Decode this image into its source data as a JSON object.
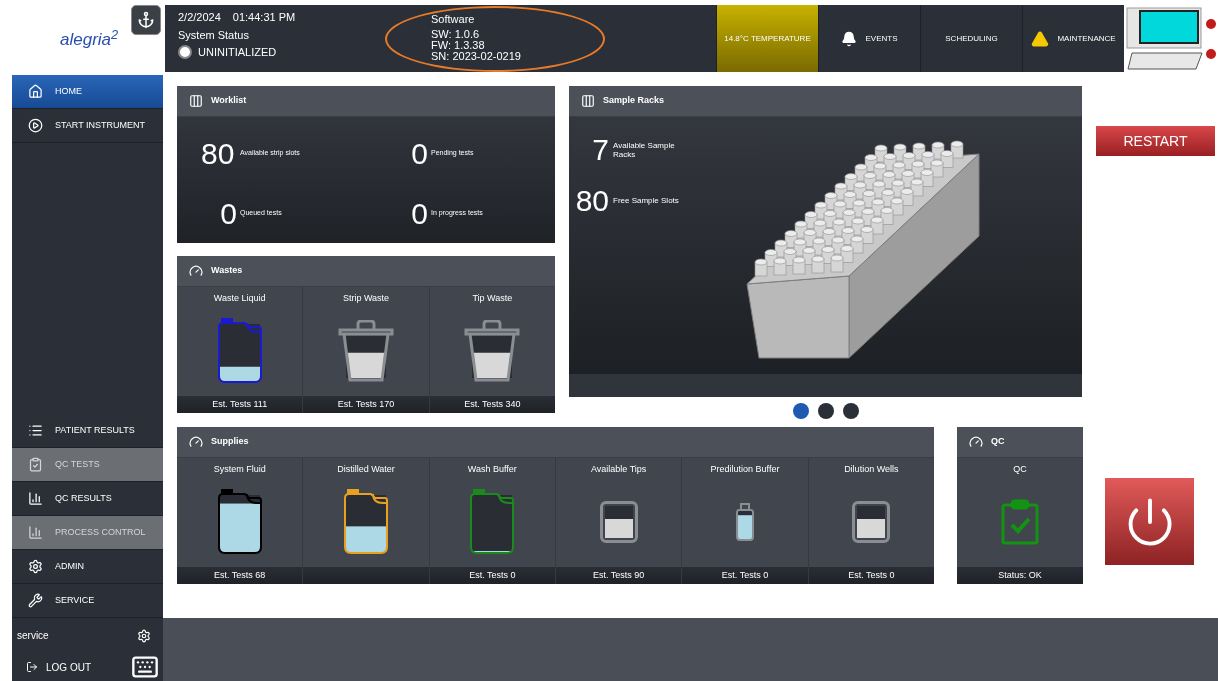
{
  "logo": {
    "text": "alegria$^{2}$"
  },
  "header": {
    "date": "2/2/2024",
    "time": "01:44:31 PM",
    "status_label": "System Status",
    "status": {
      "text": "UNINITIALIZED",
      "on": false
    },
    "software": {
      "title": "Software",
      "lines": [
        "SW: 1.0.6",
        "FW: 1.3.38",
        "SN: 2023-02-0219"
      ],
      "circled": true
    },
    "tabs": [
      {
        "label": "14.8°C TEMPERATURE",
        "kind": "plain",
        "highlighted": true
      },
      {
        "label": "EVENTS",
        "kind": "bell",
        "highlighted": false
      },
      {
        "label": "SCHEDULING",
        "kind": "plain",
        "highlighted": false
      },
      {
        "label": "MAINTENANCE",
        "kind": "warning",
        "highlighted": false
      }
    ]
  },
  "sidebar": {
    "items": [
      {
        "label": "HOME",
        "selected": true,
        "disabled": false
      },
      {
        "label": "START INSTRUMENT",
        "selected": false,
        "disabled": false
      }
    ],
    "lower_items": [
      {
        "label": "PATIENT RESULTS",
        "selected": false,
        "disabled": false
      },
      {
        "label": "QC TESTS",
        "selected": false,
        "disabled": true
      },
      {
        "label": "QC RESULTS",
        "selected": false,
        "disabled": false
      },
      {
        "label": "PROCESS CONTROL",
        "selected": false,
        "disabled": true
      },
      {
        "label": "ADMIN",
        "selected": false,
        "disabled": false
      },
      {
        "label": "SERVICE",
        "selected": false,
        "disabled": false
      }
    ],
    "user": "service",
    "logout": "LOG OUT"
  },
  "worklist": {
    "title": "Worklist",
    "stats": [
      {
        "value": "80",
        "label": "Available strip slots"
      },
      {
        "value": "0",
        "label": "Pending tests"
      },
      {
        "value": "0",
        "label": "Queued tests"
      },
      {
        "value": "0",
        "label": "In progress tests"
      }
    ]
  },
  "wastes": {
    "title": "Wastes",
    "items": [
      {
        "name": "Waste Liquid",
        "kind": "canister",
        "color": "#1a1ad0",
        "level": 0.25,
        "footer": "Est. Tests 111"
      },
      {
        "name": "Strip Waste",
        "kind": "bin",
        "color": "#8a8d92",
        "level": 0.6,
        "footer": "Est. Tests 170"
      },
      {
        "name": "Tip Waste",
        "kind": "bin",
        "color": "#8a8d92",
        "level": 0.6,
        "footer": "Est. Tests 340"
      }
    ]
  },
  "sample_racks": {
    "title": "Sample Racks",
    "stats": [
      {
        "value": "7",
        "label": "Available Sample Racks"
      },
      {
        "value": "80",
        "label": "Free Sample Slots"
      }
    ],
    "pages": [
      {
        "selected": true
      },
      {
        "selected": false
      },
      {
        "selected": false
      }
    ]
  },
  "restart_button": "RESTART",
  "supplies": {
    "title": "Supplies",
    "items": [
      {
        "name": "System Fluid",
        "kind": "canister",
        "color": "#000000",
        "level": 0.85,
        "footer": "Est. Tests 68"
      },
      {
        "name": "Distilled Water",
        "kind": "canister",
        "color": "#e8a020",
        "level": 0.45
      },
      {
        "name": "Wash Buffer",
        "kind": "canister",
        "color": "#1a8a1a",
        "level": 0,
        "footer": "Est. Tests 0"
      },
      {
        "name": "Available Tips",
        "kind": "tray",
        "color": "#8a8d92",
        "level": 0.6,
        "footer": "Est. Tests 90"
      },
      {
        "name": "Predilution Buffer",
        "kind": "bottle",
        "color": "#8a8d92",
        "level": 0.85,
        "footer": "Est. Tests 0"
      },
      {
        "name": "Dilution Wells",
        "kind": "tray",
        "color": "#8a8d92",
        "level": 0.6,
        "footer": "Est. Tests 0"
      }
    ]
  },
  "qc": {
    "title": "QC",
    "items": [
      {
        "name": "QC",
        "kind": "clipboard",
        "color": "#129412",
        "footer": "Status: OK"
      }
    ]
  }
}
